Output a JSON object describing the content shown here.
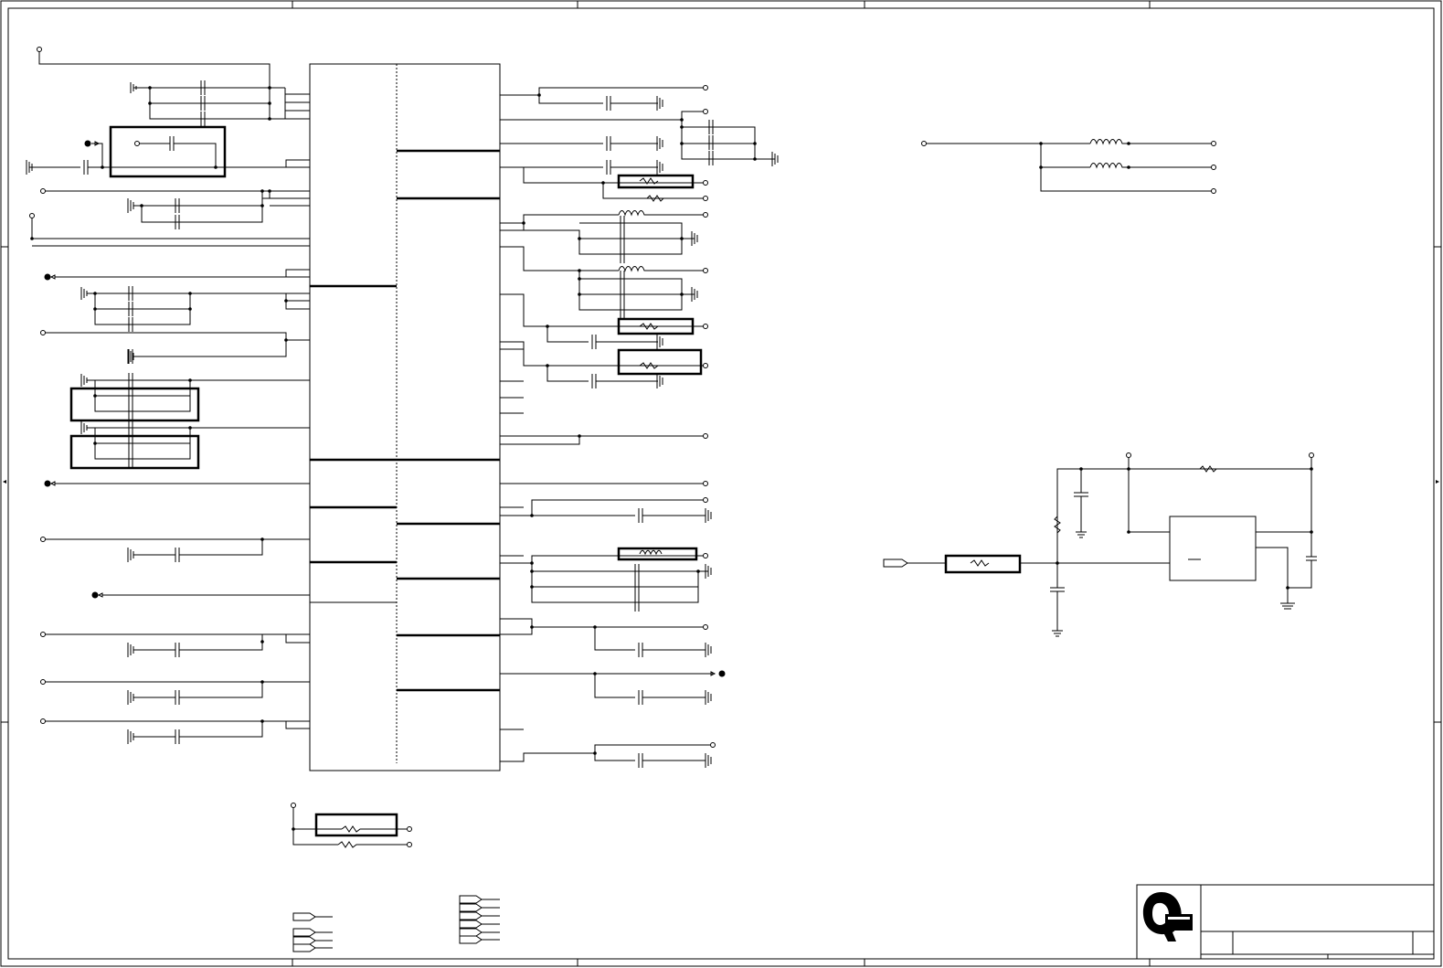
{
  "drawing": {
    "type": "circuit-schematic",
    "colors": {
      "line": "#000000",
      "background": "#ffffff"
    },
    "title_block": {
      "logo": "q-logo-icon"
    }
  }
}
